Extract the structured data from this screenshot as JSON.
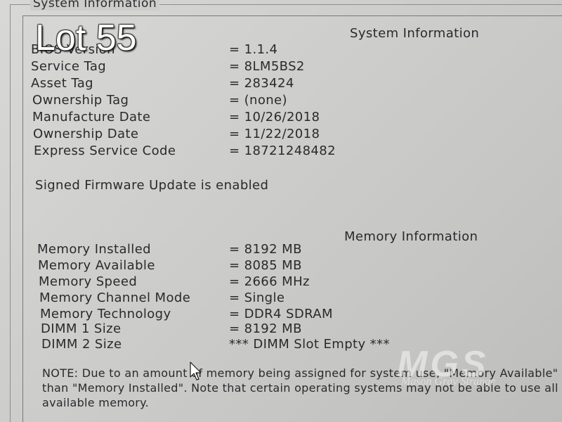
{
  "overlay": {
    "lot_label": "Lot 55"
  },
  "groupbox": {
    "title": "System Information"
  },
  "system_info": {
    "heading": "System Information",
    "rows": [
      {
        "label": "BIOS Version",
        "value": "= 1.1.4"
      },
      {
        "label": "Service Tag",
        "value": "= 8LM5BS2"
      },
      {
        "label": "Asset Tag",
        "value": "= 283424"
      },
      {
        "label": "Ownership Tag",
        "value": "= (none)"
      },
      {
        "label": "Manufacture Date",
        "value": "= 10/26/2018"
      },
      {
        "label": "Ownership Date",
        "value": "= 11/22/2018"
      },
      {
        "label": "Express Service Code",
        "value": "= 18721248482"
      }
    ],
    "firmware_status": "Signed Firmware Update is enabled"
  },
  "memory_info": {
    "heading": "Memory Information",
    "rows": [
      {
        "label": "Memory Installed",
        "value": "= 8192 MB"
      },
      {
        "label": "Memory Available",
        "value": "= 8085 MB"
      },
      {
        "label": "Memory Speed",
        "value": "= 2666 MHz"
      },
      {
        "label": "Memory Channel Mode",
        "value": "= Single"
      },
      {
        "label": "Memory Technology",
        "value": "= DDR4 SDRAM"
      },
      {
        "label": "DIMM 1 Size",
        "value": "= 8192 MB"
      },
      {
        "label": "DIMM 2 Size",
        "value": "*** DIMM Slot Empty ***"
      }
    ],
    "note_lines": [
      "NOTE: Due to an amount of memory being assigned for system use, \"Memory Available\" is less",
      "than \"Memory Installed\". Note that certain operating systems may not be able to use all the",
      "available memory."
    ]
  },
  "watermark": {
    "letters": "MGS",
    "subtitle": "Mason Gray Strange"
  },
  "colors": {
    "background": "#cfcfcd",
    "text": "#2a2a2e",
    "overlay_text": "#ffffff"
  }
}
